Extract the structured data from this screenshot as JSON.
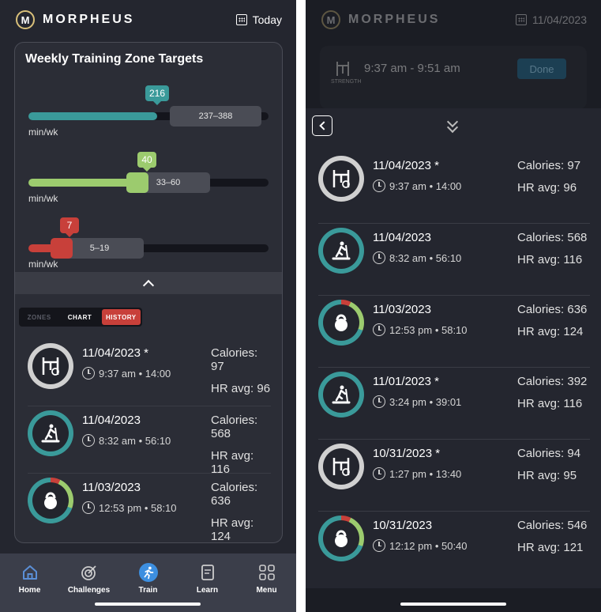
{
  "left": {
    "header": {
      "logo_letter": "M",
      "brand": "MORPHEUS",
      "date_label": "Today"
    },
    "zones_card": {
      "title": "Weekly Training Zone Targets",
      "zones": [
        {
          "value": "216",
          "range": "237–388",
          "unit": "min/wk",
          "color": "#3a9a9a"
        },
        {
          "value": "40",
          "range": "33–60",
          "unit": "min/wk",
          "color": "#9ccb6e"
        },
        {
          "value": "7",
          "range": "5–19",
          "unit": "min/wk",
          "color": "#c8403a"
        }
      ]
    },
    "tabs": {
      "zones": "ZONES",
      "chart": "CHART",
      "history": "HISTORY",
      "active": "HISTORY"
    },
    "history": [
      {
        "icon": "strength-icon",
        "date": "11/04/2023 *",
        "time": "9:37 am • 14:00",
        "calories": "Calories: 97",
        "hr": "HR avg: 96"
      },
      {
        "icon": "treadmill-icon",
        "date": "11/04/2023",
        "time": "8:32 am • 56:10",
        "calories": "Calories: 568",
        "hr": "HR avg: 116"
      },
      {
        "icon": "kettlebell-icon",
        "date": "11/03/2023",
        "time": "12:53 pm • 58:10",
        "calories": "Calories: 636",
        "hr": "HR avg: 124"
      }
    ],
    "nav": [
      {
        "label": "Home",
        "icon": "home-icon",
        "active": true
      },
      {
        "label": "Challenges",
        "icon": "target-icon",
        "active": false
      },
      {
        "label": "Train",
        "icon": "runner-icon",
        "active": false
      },
      {
        "label": "Learn",
        "icon": "document-icon",
        "active": false
      },
      {
        "label": "Menu",
        "icon": "grid-icon",
        "active": false
      }
    ]
  },
  "right": {
    "header": {
      "logo_letter": "M",
      "brand": "MORPHEUS",
      "date_label": "11/04/2023"
    },
    "session": {
      "type_label": "STRENGTH",
      "time_range": "9:37 am - 9:51 am",
      "done_label": "Done"
    },
    "history": [
      {
        "icon": "strength-icon",
        "date": "11/04/2023 *",
        "time": "9:37 am • 14:00",
        "calories": "Calories: 97",
        "hr": "HR avg: 96"
      },
      {
        "icon": "treadmill-icon",
        "date": "11/04/2023",
        "time": "8:32 am • 56:10",
        "calories": "Calories: 568",
        "hr": "HR avg: 116"
      },
      {
        "icon": "kettlebell-icon",
        "date": "11/03/2023",
        "time": "12:53 pm • 58:10",
        "calories": "Calories: 636",
        "hr": "HR avg: 124"
      },
      {
        "icon": "treadmill-icon",
        "date": "11/01/2023 *",
        "time": "3:24 pm • 39:01",
        "calories": "Calories: 392",
        "hr": "HR avg: 116"
      },
      {
        "icon": "strength-icon",
        "date": "10/31/2023 *",
        "time": "1:27 pm • 13:40",
        "calories": "Calories: 94",
        "hr": "HR avg: 95"
      },
      {
        "icon": "kettlebell-icon",
        "date": "10/31/2023",
        "time": "12:12 pm • 50:40",
        "calories": "Calories: 546",
        "hr": "HR avg: 121"
      }
    ]
  },
  "colors": {
    "teal": "#3a9a9a",
    "green": "#9ccb6e",
    "red": "#c8403a",
    "gray_ring": "#d0d0d0",
    "nav_active": "#5b8fd6",
    "train_blue": "#3d8fe0"
  }
}
